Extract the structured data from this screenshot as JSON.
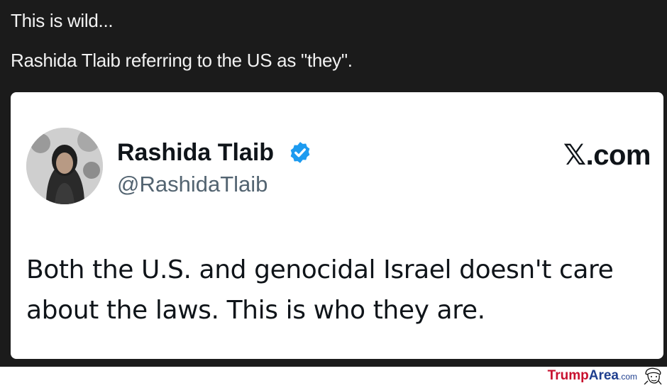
{
  "post": {
    "line1": "This is wild...",
    "line2": "Rashida Tlaib referring to the US as \"they\"."
  },
  "tweet": {
    "display_name": "Rashida Tlaib",
    "handle": "@RashidaTlaib",
    "brand": "𝕏.com",
    "text": "Both the U.S. and genocidal Israel doesn't care about the laws. This is who they are.",
    "avatar_icon": "avatar",
    "verified_icon": "verified-badge-icon"
  },
  "watermark": {
    "trump": "Trump",
    "area": "Area",
    "tld": ".com",
    "logo_icon": "caricature-logo-icon"
  },
  "colors": {
    "background": "#1b1b1b",
    "card": "#ffffff",
    "verified": "#1d9bf0",
    "handle": "#536471",
    "watermark_red": "#c8102e",
    "watermark_blue": "#1f3f8f"
  }
}
